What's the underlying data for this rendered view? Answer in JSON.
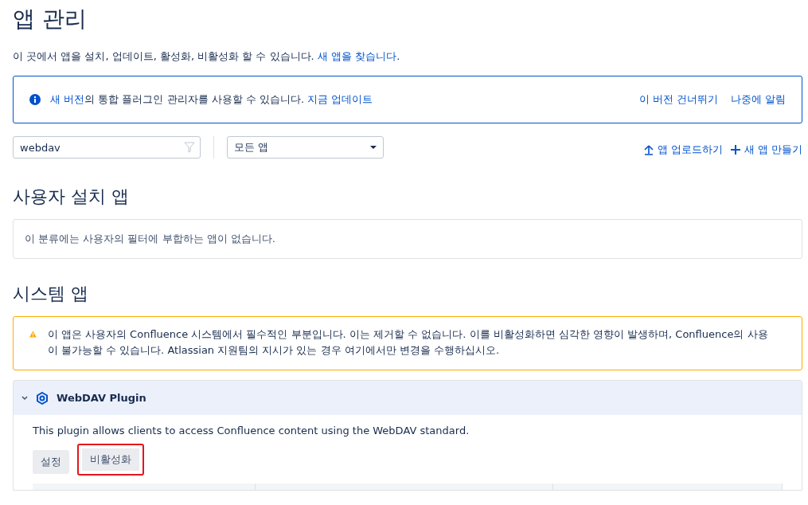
{
  "page": {
    "title": "앱 관리",
    "intro": [
      {
        "kind": "text",
        "text": "이 곳에서 앱을 설치, 업데이트, 활성화, 비활성화 할 수 있습니다. "
      },
      {
        "kind": "link",
        "text": "새 앱을 찾습니다"
      },
      {
        "kind": "text",
        "text": "."
      }
    ]
  },
  "update_banner": {
    "message": [
      {
        "kind": "link",
        "text": "새 버전"
      },
      {
        "kind": "text",
        "text": "의 통합 플러그인 관리자를 사용할 수 있습니다. "
      },
      {
        "kind": "link",
        "text": "지금 업데이트"
      }
    ],
    "actions": [
      "이 버전 건너뛰기",
      "나중에 알림"
    ]
  },
  "toolbar": {
    "search": {
      "value": "webdav"
    },
    "filter": {
      "value": "모든 앱"
    },
    "actions": [
      {
        "kind": "upload",
        "label": "앱 업로드하기"
      },
      {
        "kind": "add",
        "label": "새 앱 만들기"
      }
    ]
  },
  "sections": [
    {
      "kind": "empty",
      "title": "사용자 설치 앱",
      "message": "이 분류에는 사용자의 필터에 부합하는 앱이 없습니다."
    },
    {
      "kind": "apps",
      "title": "시스템 앱",
      "warning": "이 앱은 사용자의 Confluence 시스템에서 필수적인 부분입니다. 이는 제거할 수 없습니다. 이를 비활성화하면 심각한 영향이 발생하며, Confluence의 사용이 불가능할 수 있습니다. Atlassian 지원팀의 지시가 있는 경우 여기에서만 변경을 수행하십시오.",
      "apps": [
        {
          "name": "WebDAV Plugin",
          "expanded": true,
          "description": "This plugin allows clients to access Confluence content using the WebDAV standard.",
          "buttons": [
            {
              "label": "설정",
              "highlighted": false
            },
            {
              "label": "비활성화",
              "highlighted": true
            }
          ]
        }
      ]
    }
  ]
}
